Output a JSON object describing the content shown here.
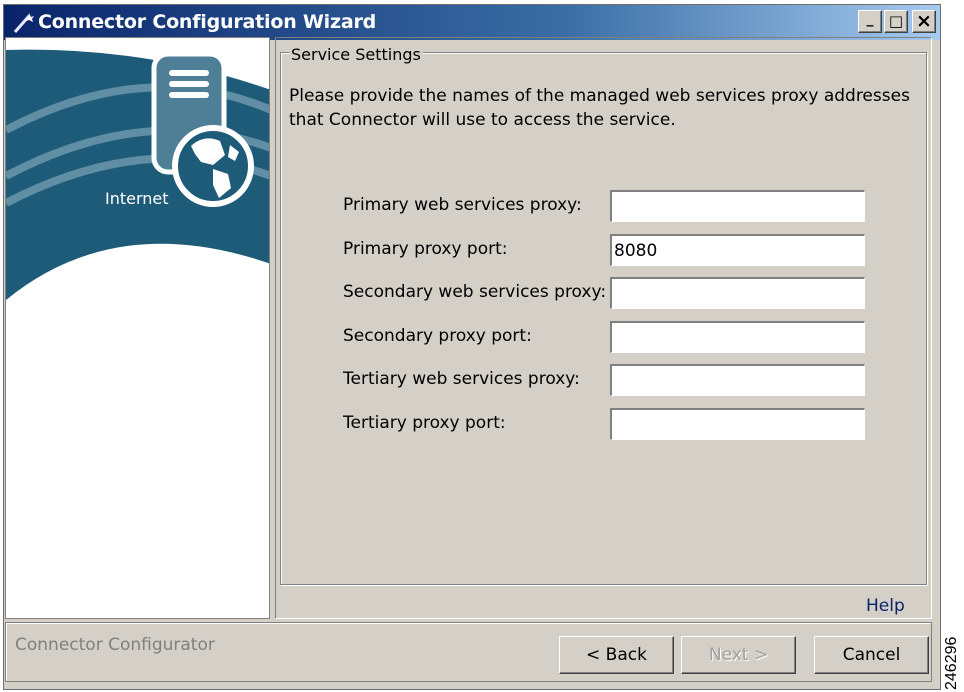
{
  "window": {
    "title": "Connector Configuration Wizard",
    "icon": "wizard-wand-icon",
    "minimize_label": "_",
    "maximize_label": "□",
    "close_label": "×"
  },
  "left_panel": {
    "graphic_label": "Internet",
    "icons": [
      "server-icon",
      "globe-icon"
    ],
    "colors": {
      "arc": "#1e5b79",
      "band": "#5f8ea5"
    }
  },
  "group": {
    "legend": "Service Settings",
    "instructions": "Please provide the names of the managed web services proxy addresses that Connector will use to access the service.",
    "fields": [
      {
        "label": "Primary web services proxy:",
        "value": ""
      },
      {
        "label": "Primary proxy port:",
        "value": "8080"
      },
      {
        "label": "Secondary web services proxy:",
        "value": ""
      },
      {
        "label": "Secondary proxy port:",
        "value": ""
      },
      {
        "label": "Tertiary web services proxy:",
        "value": ""
      },
      {
        "label": "Tertiary proxy port:",
        "value": ""
      }
    ]
  },
  "help_link": "Help",
  "footer": {
    "status": "Connector Configurator",
    "back_label": "< Back",
    "next_label": "Next >",
    "cancel_label": "Cancel"
  },
  "figure_number": "246296",
  "colors": {
    "titlebar_start": "#0a246a",
    "titlebar_end": "#a6caf0",
    "face": "#d4d0c8",
    "link": "#0a246a"
  }
}
